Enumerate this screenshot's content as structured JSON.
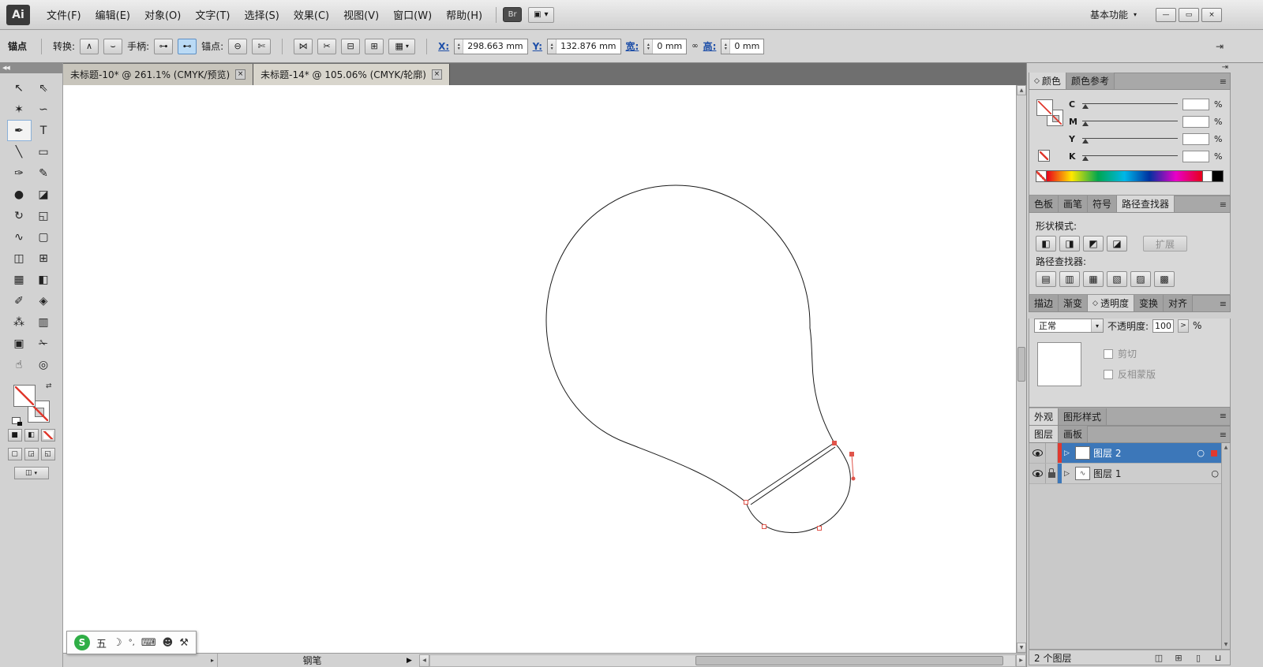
{
  "menubar": {
    "logo": "Ai",
    "items": [
      "文件(F)",
      "编辑(E)",
      "对象(O)",
      "文字(T)",
      "选择(S)",
      "效果(C)",
      "视图(V)",
      "窗口(W)",
      "帮助(H)"
    ],
    "bridge": "Br",
    "arrange_icon": "▣",
    "arrange_caret": "▾",
    "workspace": "基本功能",
    "workspace_caret": "▾",
    "min_icon": "—",
    "restore_icon": "▭",
    "close_icon": "×"
  },
  "controlbar": {
    "title": "锚点",
    "convert_label": "转换:",
    "convert_corner_icon": "∧",
    "convert_smooth_icon": "⌣",
    "handles_label": "手柄:",
    "handle_show_icon": "⊶",
    "handle_hide_icon": "⊷",
    "anchors_label": "锚点:",
    "anchor_remove_icon": "⊖",
    "anchor_cut_icon": "✄",
    "connect_icon": "⋈",
    "scissors_icon": "✂",
    "handles_multi_icon": "⊟",
    "grid_icon": "⊞",
    "transform_icon": "▦",
    "transform_caret": "▾",
    "stepper_up": "▴",
    "stepper_down": "▾",
    "x_label": "X:",
    "x_value": "298.663 mm",
    "y_label": "Y:",
    "y_value": "132.876 mm",
    "w_label": "宽:",
    "w_value": "0 mm",
    "link_icon": "∞",
    "h_label": "高:",
    "h_value": "0 mm",
    "collapse_icon": "⇥"
  },
  "toolpanel": {
    "collapse_icon": "◀◀",
    "swap_icon": "⇄",
    "color_icon": "■",
    "gradient_icon": "◧",
    "draw_normal_icon": "▢",
    "draw_behind_icon": "◲",
    "draw_inside_icon": "◱",
    "screen_mode_icon": "◫",
    "screen_mode_caret": "▾"
  },
  "tools": [
    {
      "name": "selection-tool",
      "glyph": "↖"
    },
    {
      "name": "direct-selection-tool",
      "glyph": "⇖"
    },
    {
      "name": "magic-wand-tool",
      "glyph": "✶"
    },
    {
      "name": "lasso-tool",
      "glyph": "∽"
    },
    {
      "name": "pen-tool",
      "glyph": "✒",
      "selected": true
    },
    {
      "name": "type-tool",
      "glyph": "T"
    },
    {
      "name": "line-segment-tool",
      "glyph": "╲"
    },
    {
      "name": "rectangle-tool",
      "glyph": "▭"
    },
    {
      "name": "paintbrush-tool",
      "glyph": "✑"
    },
    {
      "name": "pencil-tool",
      "glyph": "✎"
    },
    {
      "name": "blob-brush-tool",
      "glyph": "●"
    },
    {
      "name": "eraser-tool",
      "glyph": "◪"
    },
    {
      "name": "rotate-tool",
      "glyph": "↻"
    },
    {
      "name": "scale-tool",
      "glyph": "◱"
    },
    {
      "name": "width-tool",
      "glyph": "∿"
    },
    {
      "name": "free-transform-tool",
      "glyph": "▢"
    },
    {
      "name": "shape-builder-tool",
      "glyph": "◫"
    },
    {
      "name": "perspective-grid-tool",
      "glyph": "⊞"
    },
    {
      "name": "mesh-tool",
      "glyph": "▦"
    },
    {
      "name": "gradient-tool",
      "glyph": "◧"
    },
    {
      "name": "eyedropper-tool",
      "glyph": "✐"
    },
    {
      "name": "blend-tool",
      "glyph": "◈"
    },
    {
      "name": "symbol-sprayer-tool",
      "glyph": "⁂"
    },
    {
      "name": "column-graph-tool",
      "glyph": "▥"
    },
    {
      "name": "artboard-tool",
      "glyph": "▣"
    },
    {
      "name": "slice-tool",
      "glyph": "✁"
    },
    {
      "name": "hand-tool",
      "glyph": "☝"
    },
    {
      "name": "zoom-tool",
      "glyph": "◎"
    }
  ],
  "doc_tabs": [
    {
      "label": "未标题-10* @ 261.1% (CMYK/预览)",
      "close": "×"
    },
    {
      "label": "未标题-14* @ 105.06% (CMYK/轮廓)",
      "close": "×"
    }
  ],
  "dock": {
    "collapse_icon": "⇥",
    "menu_icon": "≡",
    "toggle_icon": "◇"
  },
  "color_panel": {
    "tab_color": "颜色",
    "tab_guide": "颜色参考",
    "channels": [
      "C",
      "M",
      "Y",
      "K"
    ],
    "values": [
      "",
      "",
      "",
      ""
    ],
    "percent": "%"
  },
  "pathfinder_panel": {
    "tab_swatches": "色板",
    "tab_brushes": "画笔",
    "tab_symbols": "符号",
    "tab_pathfinder": "路径查找器",
    "shape_modes_label": "形状模式:",
    "shape_mode_icons": [
      "◧",
      "◨",
      "◩",
      "◪"
    ],
    "expand_label": "扩展",
    "pathfinders_label": "路径查找器:",
    "pathfinder_icons": [
      "▤",
      "▥",
      "▦",
      "▧",
      "▨",
      "▩"
    ]
  },
  "transparency_panel": {
    "tab_stroke": "描边",
    "tab_gradient": "渐变",
    "tab_transparency": "透明度",
    "tab_transform": "变换",
    "tab_align": "对齐",
    "blend_mode": "正常",
    "dropdown_caret": "▾",
    "opacity_label": "不透明度:",
    "opacity_value": "100",
    "flyout_icon": ">",
    "percent": "%",
    "clip_label": "剪切",
    "invert_label": "反相蒙版"
  },
  "appearance_panel": {
    "tab_appearance": "外观",
    "tab_styles": "图形样式"
  },
  "layers_panel": {
    "tab_layers": "图层",
    "tab_artboards": "画板",
    "expand_icon": "▷",
    "target_icon": "○",
    "rows": [
      {
        "name": "图层 2"
      },
      {
        "name": "图层 1",
        "thumb_glyph": "∿"
      }
    ],
    "count_label": "2 个图层",
    "clip_mask_icon": "◫",
    "new_sublayer_icon": "⊞",
    "new_layer_icon": "▯",
    "delete_icon": "⊔"
  },
  "statusbar": {
    "divider_icon": "▸",
    "tool": "钢笔",
    "flyout_icon": "▶"
  },
  "ime": {
    "logo": "S",
    "mode": "五",
    "shape_icon": "☽",
    "punct_icon": "°,",
    "keyboard_icon": "⌨",
    "user_icon": "☻",
    "wrench_icon": "⚒"
  },
  "scroll": {
    "up": "▲",
    "down": "▼",
    "left": "◀",
    "right": "▶"
  }
}
